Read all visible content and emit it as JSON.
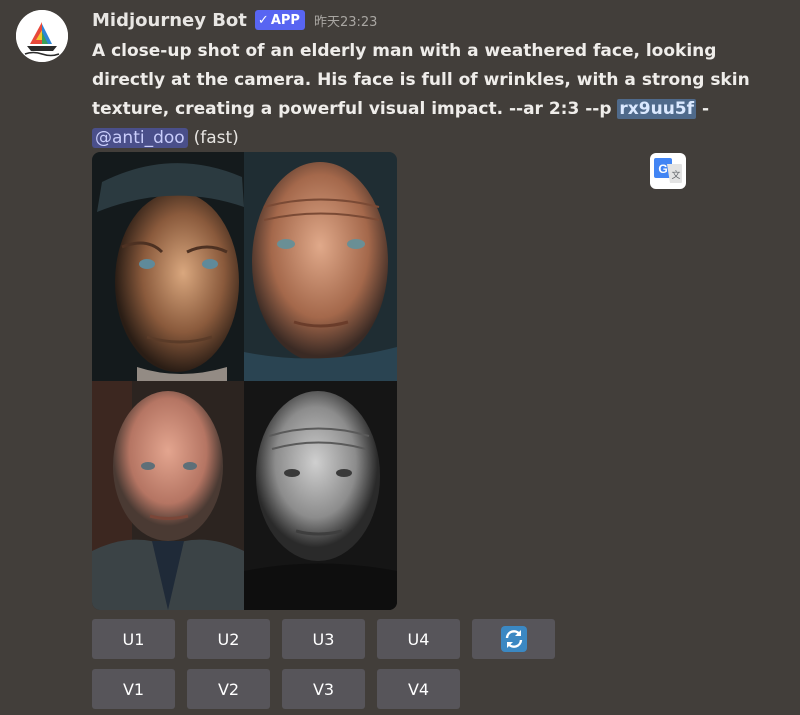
{
  "message": {
    "author": "Midjourney Bot",
    "badge": "APP",
    "timestamp": "昨天23:23",
    "prompt": "A close-up shot of an elderly man with a weathered face, looking directly at the camera. His face is full of wrinkles, with a strong skin texture, creating a powerful visual impact. --ar 2:3 --p ",
    "job_id": "rx9uu5f",
    "separator": " - ",
    "mention": "@anti_doo",
    "speed": "(fast)"
  },
  "images": [
    {
      "name": "portrait-1"
    },
    {
      "name": "portrait-2"
    },
    {
      "name": "portrait-3"
    },
    {
      "name": "portrait-4"
    }
  ],
  "buttons": {
    "row1": [
      "U1",
      "U2",
      "U3",
      "U4"
    ],
    "row2": [
      "V1",
      "V2",
      "V3",
      "V4"
    ],
    "reroll_icon": "refresh-icon"
  },
  "colors": {
    "background": "#423e3a",
    "badge": "#5865f2",
    "button": "#57555a",
    "highlight": "#4f6a8b",
    "mention": "#4a4f8a"
  }
}
